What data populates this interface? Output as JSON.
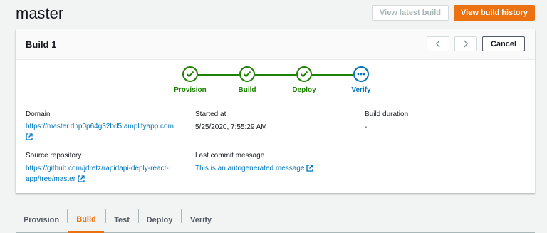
{
  "header": {
    "title": "master",
    "view_latest_label": "View latest build",
    "view_history_label": "View build history"
  },
  "panel": {
    "title": "Build 1",
    "cancel_label": "Cancel",
    "nav_prev_icon": "chevron-left-icon",
    "nav_next_icon": "chevron-right-icon"
  },
  "steps": [
    {
      "label": "Provision",
      "status": "complete",
      "icon": "check-circle-icon"
    },
    {
      "label": "Build",
      "status": "complete",
      "icon": "check-circle-icon"
    },
    {
      "label": "Deploy",
      "status": "complete",
      "icon": "check-circle-icon"
    },
    {
      "label": "Verify",
      "status": "in-progress",
      "icon": "ellipsis-circle-icon"
    }
  ],
  "details": {
    "domain_label": "Domain",
    "domain_value": "https://master.dnp0p64g32bd5.amplifyapp.com",
    "source_label": "Source repository",
    "source_value_line1": "https://github.com/jdretz/rapidapi-deply-react-",
    "source_value_line2": "app/tree/master",
    "started_label": "Started at",
    "started_value": "5/25/2020, 7:55:29 AM",
    "commit_label": "Last commit message",
    "commit_value": "This is an autogenerated message",
    "duration_label": "Build duration",
    "duration_value": "-"
  },
  "tabs": [
    {
      "label": "Provision",
      "active": false
    },
    {
      "label": "Build",
      "active": true
    },
    {
      "label": "Test",
      "active": false
    },
    {
      "label": "Deploy",
      "active": false
    },
    {
      "label": "Verify",
      "active": false
    }
  ],
  "colors": {
    "accent": "#ec7211",
    "success": "#1d8102",
    "link": "#0073bb"
  }
}
